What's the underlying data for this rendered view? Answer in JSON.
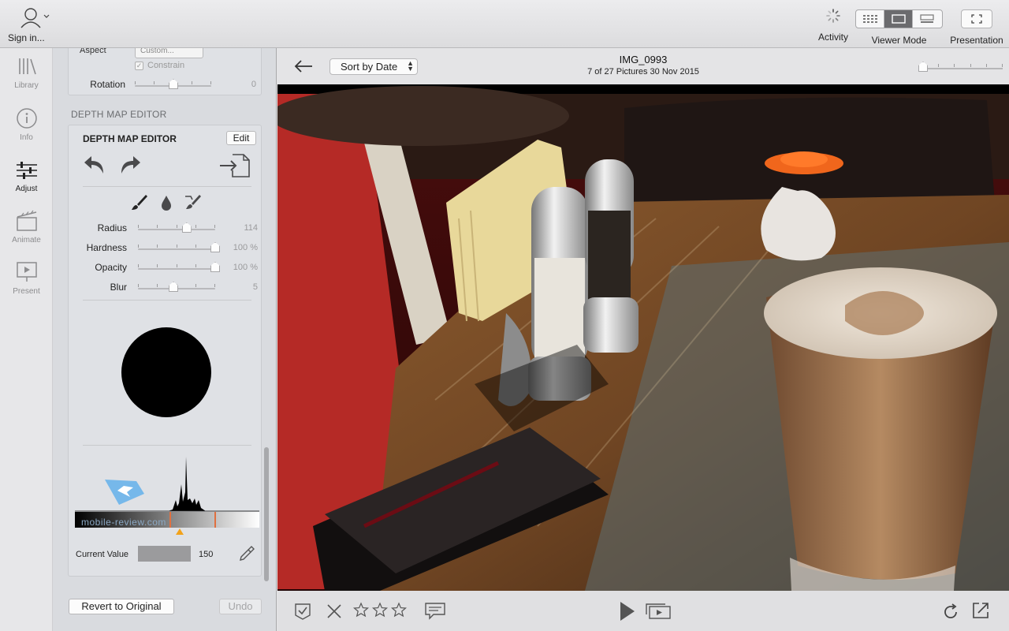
{
  "toolbar": {
    "sign_in": "Sign in...",
    "activity": "Activity",
    "viewer_mode": "Viewer Mode",
    "presentation": "Presentation"
  },
  "rail": {
    "items": [
      {
        "label": "Library",
        "icon": "library-icon"
      },
      {
        "label": "Info",
        "icon": "info-icon"
      },
      {
        "label": "Adjust",
        "icon": "sliders-icon",
        "active": true
      },
      {
        "label": "Animate",
        "icon": "clapperboard-icon"
      },
      {
        "label": "Present",
        "icon": "presentation-screen-icon"
      }
    ]
  },
  "crop": {
    "aspect_label": "Aspect",
    "aspect_value": "Custom...",
    "constrain_label": "Constrain",
    "constrain_checked": true,
    "rotation_label": "Rotation",
    "rotation_value": "0"
  },
  "depth_map": {
    "section_title": "DEPTH MAP EDITOR",
    "card_title": "DEPTH MAP EDITOR",
    "edit_label": "Edit",
    "sliders": [
      {
        "label": "Radius",
        "value": "114",
        "fraction": 0.63
      },
      {
        "label": "Hardness",
        "value": "100 %",
        "fraction": 1.0
      },
      {
        "label": "Opacity",
        "value": "100 %",
        "fraction": 1.0
      },
      {
        "label": "Blur",
        "value": "5",
        "fraction": 0.46
      }
    ],
    "current_value_label": "Current Value",
    "current_value": "150",
    "watermark": "mobile-review.com"
  },
  "footer": {
    "revert_label": "Revert to Original",
    "undo_label": "Undo"
  },
  "viewer": {
    "sort_label": "Sort by Date",
    "image_name": "IMG_0993",
    "image_meta": "7 of 27 Pictures  30 Nov 2015",
    "rating": 0,
    "rating_max": 3
  },
  "colors": {
    "accent_active_segment": "#6b6b6e",
    "histogram_marker": "#e07040",
    "histogram_pointer": "#f2a21a"
  }
}
